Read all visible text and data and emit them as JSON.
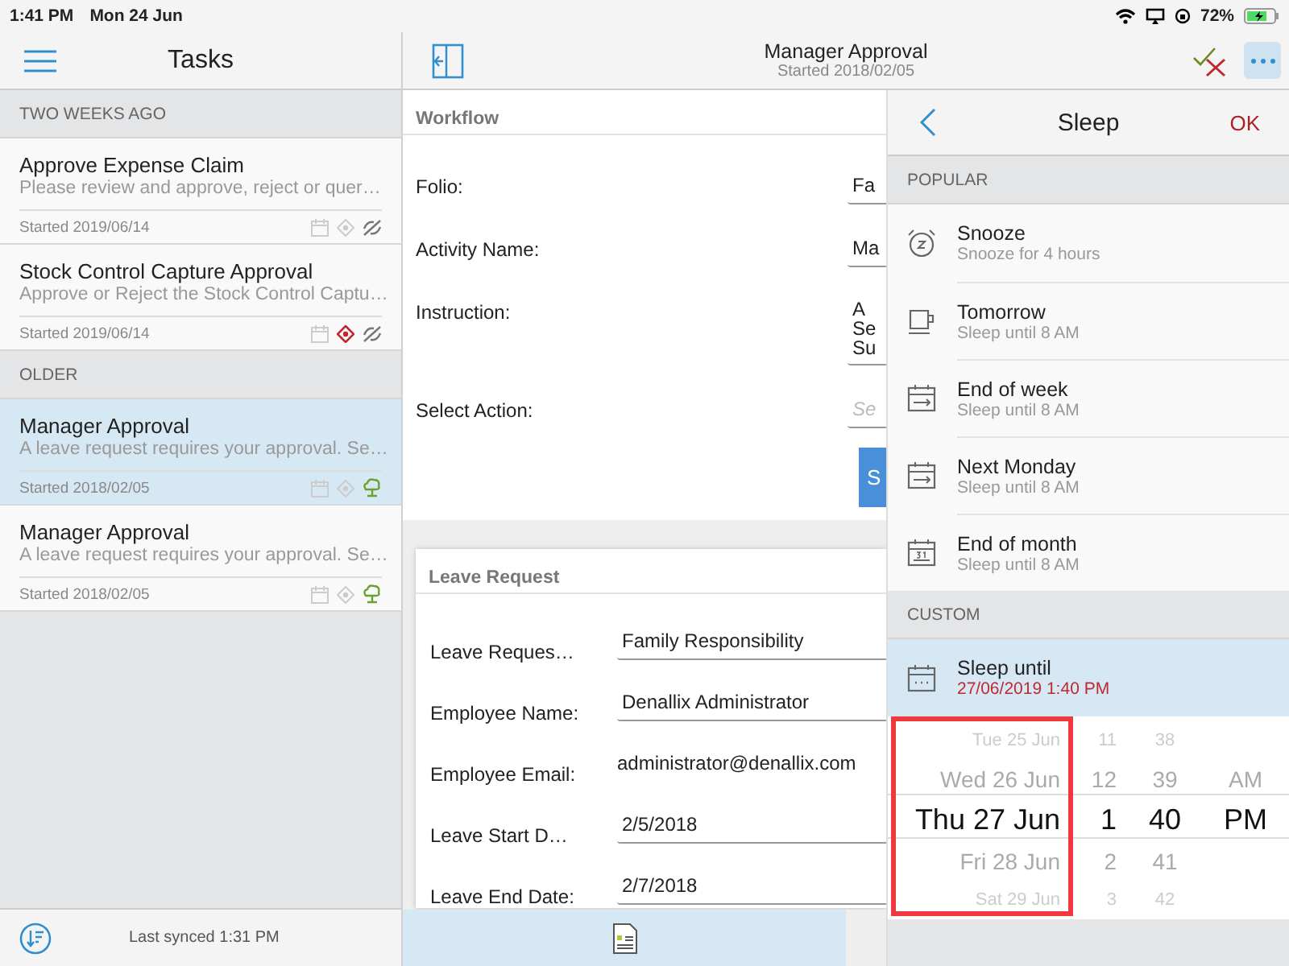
{
  "status_bar": {
    "time": "1:41 PM",
    "date": "Mon 24 Jun",
    "battery": "72%"
  },
  "tasks_panel": {
    "title": "Tasks",
    "groups": [
      {
        "heading": "TWO WEEKS AGO",
        "items": [
          {
            "title": "Approve Expense Claim",
            "subtitle": "Please review and approve, reject or quer…",
            "started": "Started 2019/06/14",
            "selected": false,
            "flagged": false,
            "kind": "slashed"
          },
          {
            "title": "Stock Control Capture Approval",
            "subtitle": "Approve or Reject the Stock Control Captu…",
            "started": "Started 2019/06/14",
            "selected": false,
            "flagged": true,
            "kind": "slashed"
          }
        ]
      },
      {
        "heading": "OLDER",
        "items": [
          {
            "title": "Manager Approval",
            "subtitle": "A leave request requires your approval. Se…",
            "started": "Started 2018/02/05",
            "selected": true,
            "flagged": false,
            "kind": "tree"
          },
          {
            "title": "Manager Approval",
            "subtitle": "A leave request requires your approval. Se…",
            "started": "Started 2018/02/05",
            "selected": false,
            "flagged": false,
            "kind": "tree"
          }
        ]
      }
    ],
    "footer": "Last synced 1:31 PM"
  },
  "task_header": {
    "title": "Manager Approval",
    "subtitle": "Started 2018/02/05"
  },
  "workflow": {
    "heading": "Workflow",
    "fields": [
      {
        "label": "Folio:",
        "kind": "field",
        "value": "Fa"
      },
      {
        "label": "Activity Name:",
        "kind": "field",
        "value": "Ma"
      },
      {
        "label": "Instruction:",
        "kind": "multiline",
        "lines": [
          "A",
          "Se",
          "Su"
        ]
      },
      {
        "label": "Select Action:",
        "kind": "select",
        "placeholder": "Se"
      }
    ],
    "button": "S"
  },
  "leave_request": {
    "heading": "Leave Request",
    "fields": [
      {
        "label": "Leave Reques…",
        "kind": "field",
        "value": "Family Responsibility"
      },
      {
        "label": "Employee Name:",
        "kind": "field",
        "value": "Denallix Administrator"
      },
      {
        "label": "Employee Email:",
        "kind": "text",
        "value": "administrator@denallix.com"
      },
      {
        "label": "Leave Start D…",
        "kind": "field",
        "value": "2/5/2018"
      },
      {
        "label": "Leave End Date:",
        "kind": "field",
        "value": "2/7/2018"
      }
    ]
  },
  "sleep_panel": {
    "title": "Sleep",
    "ok": "OK",
    "popular_heading": "POPULAR",
    "options": [
      {
        "title": "Snooze",
        "subtitle": "Snooze for 4 hours",
        "kind": "alarm"
      },
      {
        "title": "Tomorrow",
        "subtitle": "Sleep until 8 AM",
        "kind": "cup"
      },
      {
        "title": "End of week",
        "subtitle": "Sleep until 8 AM",
        "kind": "calendar-arrow"
      },
      {
        "title": "Next Monday",
        "subtitle": "Sleep until 8 AM",
        "kind": "calendar-arrow"
      },
      {
        "title": "End of month",
        "subtitle": "Sleep until 8 AM",
        "kind": "calendar-31"
      }
    ],
    "custom_heading": "CUSTOM",
    "custom": {
      "title": "Sleep until",
      "value": "27/06/2019 1:40 PM",
      "selected": true
    },
    "picker": {
      "columns": [
        {
          "items": [
            {
              "text": "Tue 25 Jun",
              "selected": false
            },
            {
              "text": "Wed 26 Jun",
              "selected": false
            },
            {
              "text": "Thu 27 Jun",
              "selected": true
            },
            {
              "text": "Fri 28 Jun",
              "selected": false
            },
            {
              "text": "Sat 29 Jun",
              "selected": false
            }
          ]
        },
        {
          "items": [
            {
              "text": "11",
              "selected": false
            },
            {
              "text": "12",
              "selected": false
            },
            {
              "text": "1",
              "selected": true
            },
            {
              "text": "2",
              "selected": false
            },
            {
              "text": "3",
              "selected": false
            }
          ]
        },
        {
          "items": [
            {
              "text": "38",
              "selected": false
            },
            {
              "text": "39",
              "selected": false
            },
            {
              "text": "40",
              "selected": true
            },
            {
              "text": "41",
              "selected": false
            },
            {
              "text": "42",
              "selected": false
            }
          ]
        },
        {
          "items": [
            {
              "text": "AM",
              "selected": false
            },
            {
              "text": "PM",
              "selected": true
            }
          ]
        }
      ]
    }
  }
}
